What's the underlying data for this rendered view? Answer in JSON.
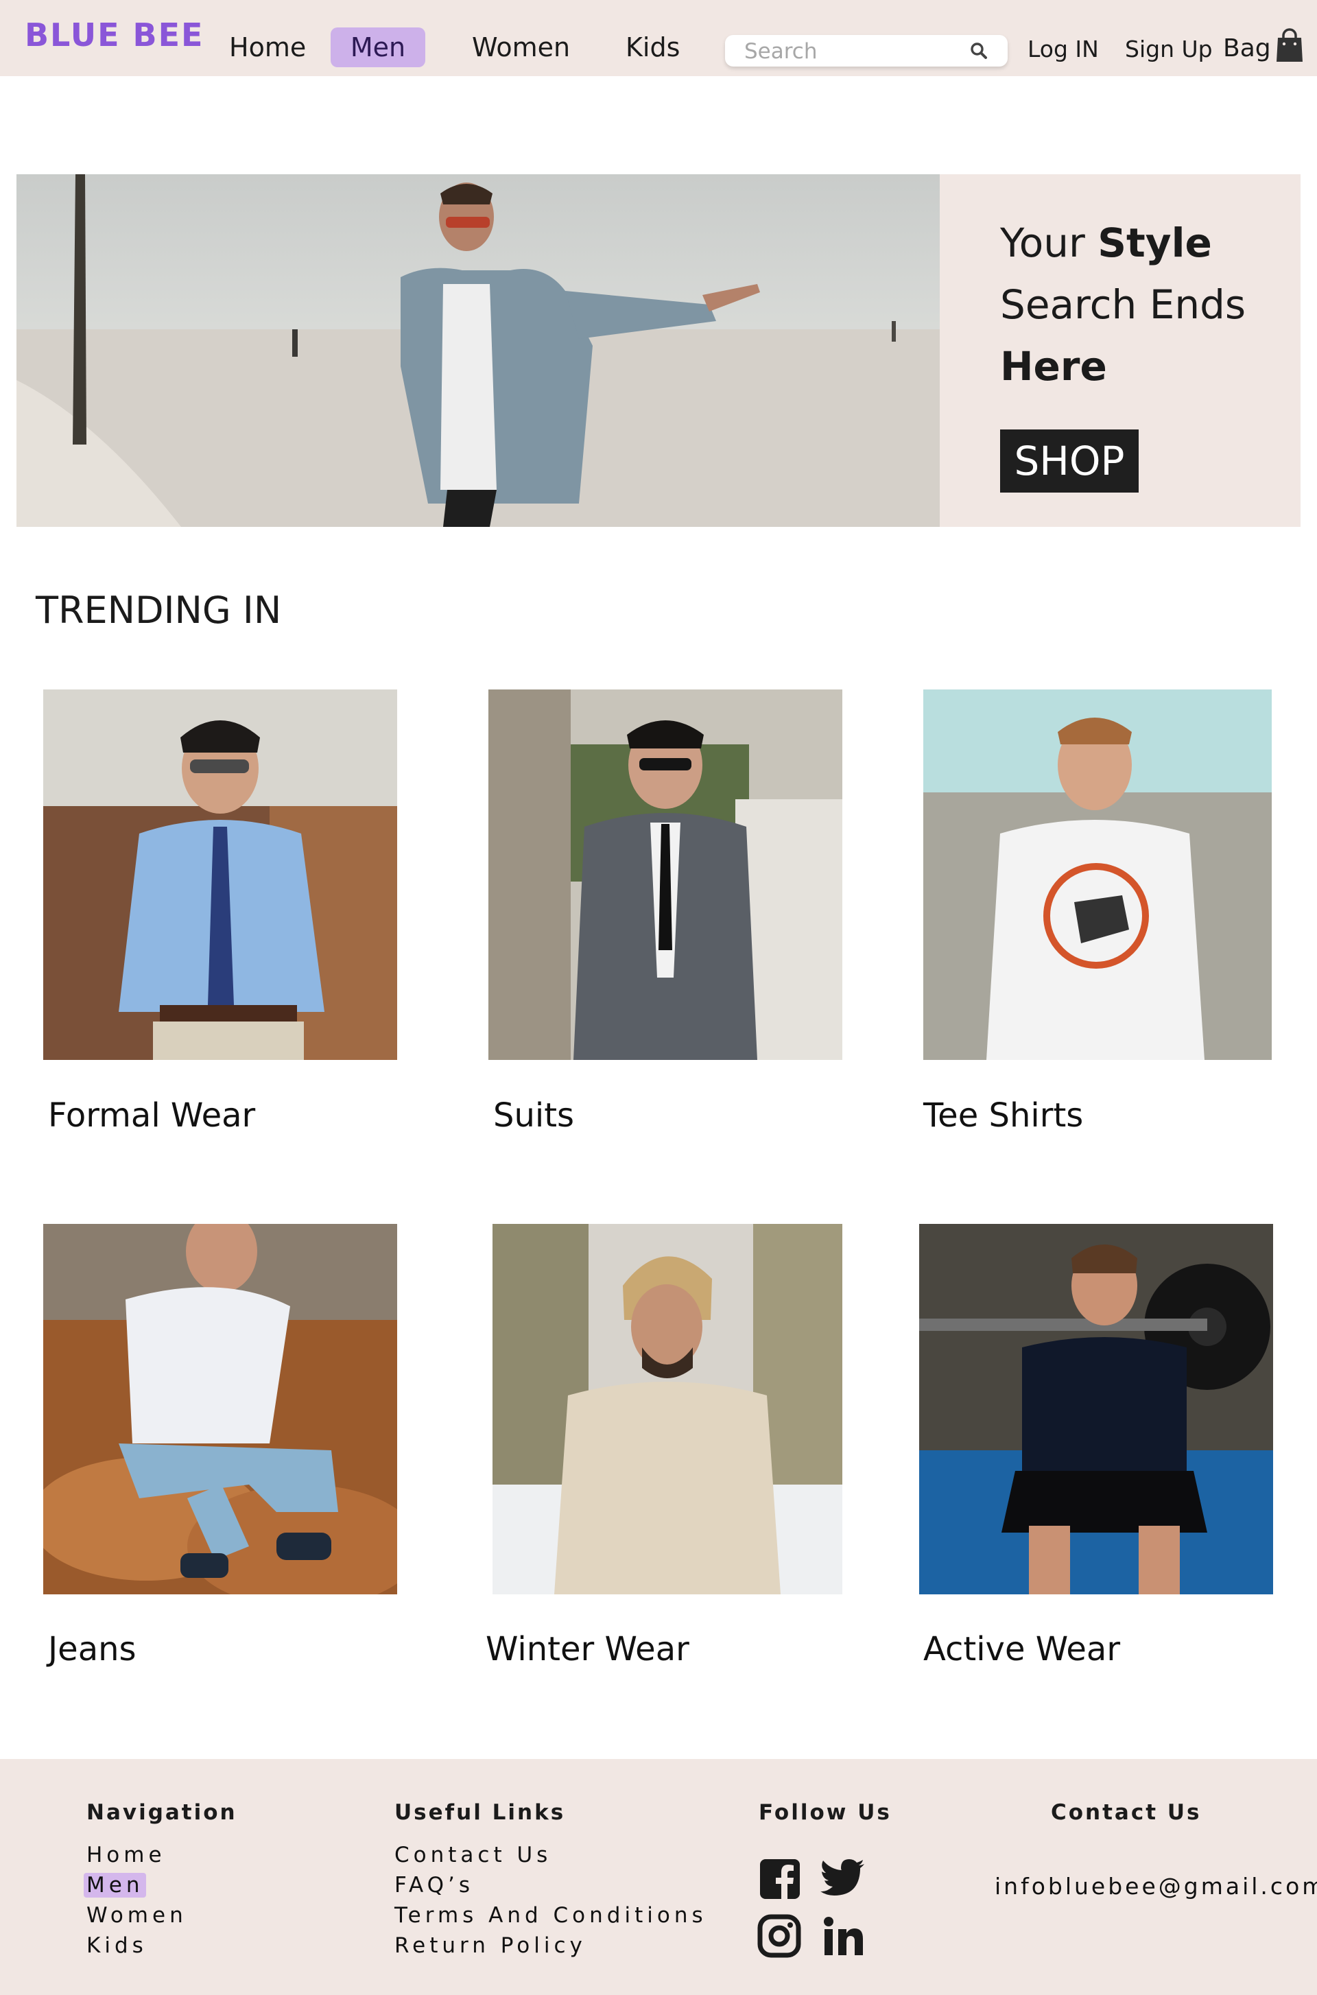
{
  "brand": {
    "name": "BLUE BEE",
    "color": "#8a56d8"
  },
  "nav": {
    "items": [
      {
        "label": "Home"
      },
      {
        "label": "Men",
        "active": true
      },
      {
        "label": "Women"
      },
      {
        "label": "Kids"
      }
    ],
    "active_bg": "#cdb1ea"
  },
  "search": {
    "placeholder": "Search",
    "icon": "search-icon"
  },
  "header_links": {
    "login": "Log IN",
    "signup": "Sign Up",
    "bag": "Bag",
    "bag_icon": "shopping-bag-icon"
  },
  "hero": {
    "line1_regular": "Your",
    "line1_bold": "Style",
    "line2": "Search Ends",
    "line3_bold": "Here",
    "button": "SHOP"
  },
  "trending": {
    "title": "TRENDING IN",
    "cards": [
      {
        "label": "Formal Wear"
      },
      {
        "label": "Suits"
      },
      {
        "label": "Tee Shirts"
      },
      {
        "label": "Jeans"
      },
      {
        "label": "Winter Wear"
      },
      {
        "label": "Active Wear"
      }
    ]
  },
  "footer": {
    "navigation": {
      "heading": "Navigation",
      "links": [
        "Home",
        "Men",
        "Women",
        "Kids"
      ],
      "active_index": 1
    },
    "useful_links": {
      "heading": "Useful  Links",
      "links": [
        "Contact Us",
        "FAQ’s",
        "Terms And Conditions",
        "Return Policy"
      ]
    },
    "follow": {
      "heading": "Follow Us",
      "icons": [
        "facebook-icon",
        "twitter-icon",
        "instagram-icon",
        "linkedin-icon"
      ]
    },
    "contact": {
      "heading": "Contact Us",
      "email": "infobluebee@gmail.com"
    }
  }
}
